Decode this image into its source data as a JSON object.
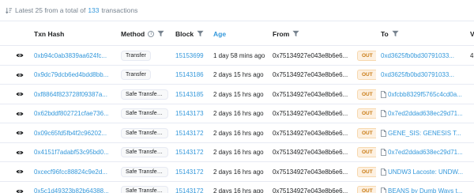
{
  "summary": {
    "prefix": "Latest 25 from a total of",
    "count": "133",
    "suffix": "transactions"
  },
  "columns": {
    "txn_hash": "Txn Hash",
    "method": "Method",
    "block": "Block",
    "age": "Age",
    "from": "From",
    "to": "To",
    "value": "V"
  },
  "rows": [
    {
      "hash": "0xb94c0ab3839aa624fc...",
      "method": "Transfer",
      "block": "15153699",
      "age": "1 day 58 mins ago",
      "from": "0x75134927e043e8b6e6...",
      "dir": "OUT",
      "to": "0xd3625fb0bd30791033...",
      "contract": false,
      "value": "4"
    },
    {
      "hash": "0x9dc79dcb6ed4bdd8bb...",
      "method": "Transfer",
      "block": "15143186",
      "age": "2 days 15 hrs ago",
      "from": "0x75134927e043e8b6e6...",
      "dir": "OUT",
      "to": "0xd3625fb0bd30791033...",
      "contract": false,
      "value": ""
    },
    {
      "hash": "0xf8864f823728f09387a...",
      "method": "Safe Transfer Fr...",
      "block": "15143185",
      "age": "2 days 15 hrs ago",
      "from": "0x75134927e043e8b6e6...",
      "dir": "OUT",
      "to": "0xfcbb8329f5765c4cd0a...",
      "contract": true,
      "value": ""
    },
    {
      "hash": "0x62bddf802721cfae736...",
      "method": "Safe Transfer Fr...",
      "block": "15143173",
      "age": "2 days 16 hrs ago",
      "from": "0x75134927e043e8b6e6...",
      "dir": "OUT",
      "to": "0x7ed2ddad638ec29d71...",
      "contract": true,
      "value": ""
    },
    {
      "hash": "0x09c65fd5fb4f2c96202...",
      "method": "Safe Transfer Fr...",
      "block": "15143172",
      "age": "2 days 16 hrs ago",
      "from": "0x75134927e043e8b6e6...",
      "dir": "OUT",
      "to": "GENE_SIS: GENESIS T...",
      "contract": true,
      "value": ""
    },
    {
      "hash": "0x4151f7adabf53c95bd0...",
      "method": "Safe Transfer Fr...",
      "block": "15143172",
      "age": "2 days 16 hrs ago",
      "from": "0x75134927e043e8b6e6...",
      "dir": "OUT",
      "to": "0x7ed2ddad638ec29d71...",
      "contract": true,
      "value": ""
    },
    {
      "hash": "0xcecf96fcc88824c9e2d...",
      "method": "Safe Transfer Fr...",
      "block": "15143172",
      "age": "2 days 16 hrs ago",
      "from": "0x75134927e043e8b6e6...",
      "dir": "OUT",
      "to": "UNDW3 Lacoste: UNDW...",
      "contract": true,
      "value": ""
    },
    {
      "hash": "0x5c1d49323b82b64388...",
      "method": "Safe Transfer Fr...",
      "block": "15143172",
      "age": "2 days 16 hrs ago",
      "from": "0x75134927e043e8b6e6...",
      "dir": "OUT",
      "to": "BEANS by Dumb Ways t...",
      "contract": true,
      "value": ""
    }
  ],
  "colors": {
    "link": "#3498db",
    "out_badge_bg": "#fdf0e0",
    "out_badge_text": "#c97b14",
    "border": "#e7eaf3"
  }
}
